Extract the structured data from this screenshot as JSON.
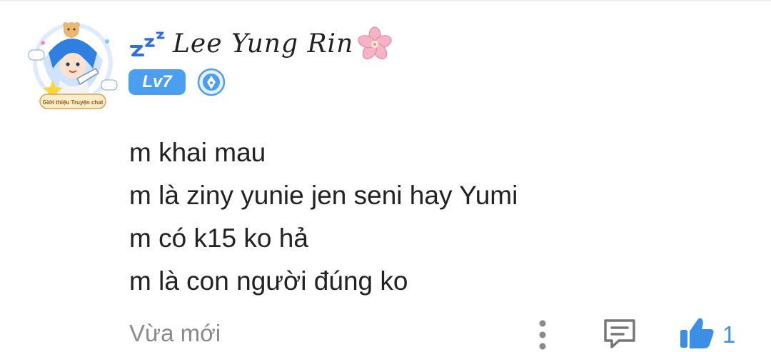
{
  "user": {
    "name": "Lee Yung Rin",
    "level": "Lv7",
    "avatar_frame_caption": "Giới thiệu Truyện chat"
  },
  "message": {
    "lines": [
      "m khai mau",
      "m là ziny yunie jen seni hay Yumi",
      "m có k15 ko hả",
      "m là con người đúng ko"
    ]
  },
  "footer": {
    "timestamp": "Vừa mới",
    "like_count": "1"
  },
  "icons": {
    "name_prefix": "zzz-icon",
    "name_suffix": "sakura-icon",
    "badge": "pen-nib-badge-icon",
    "more": "vertical-dots-icon",
    "comment": "comment-icon",
    "like": "thumbs-up-icon"
  },
  "colors": {
    "accent": "#4a9ff1",
    "text": "#222222",
    "muted": "#8a8a8a",
    "like": "#3d8fe6"
  }
}
